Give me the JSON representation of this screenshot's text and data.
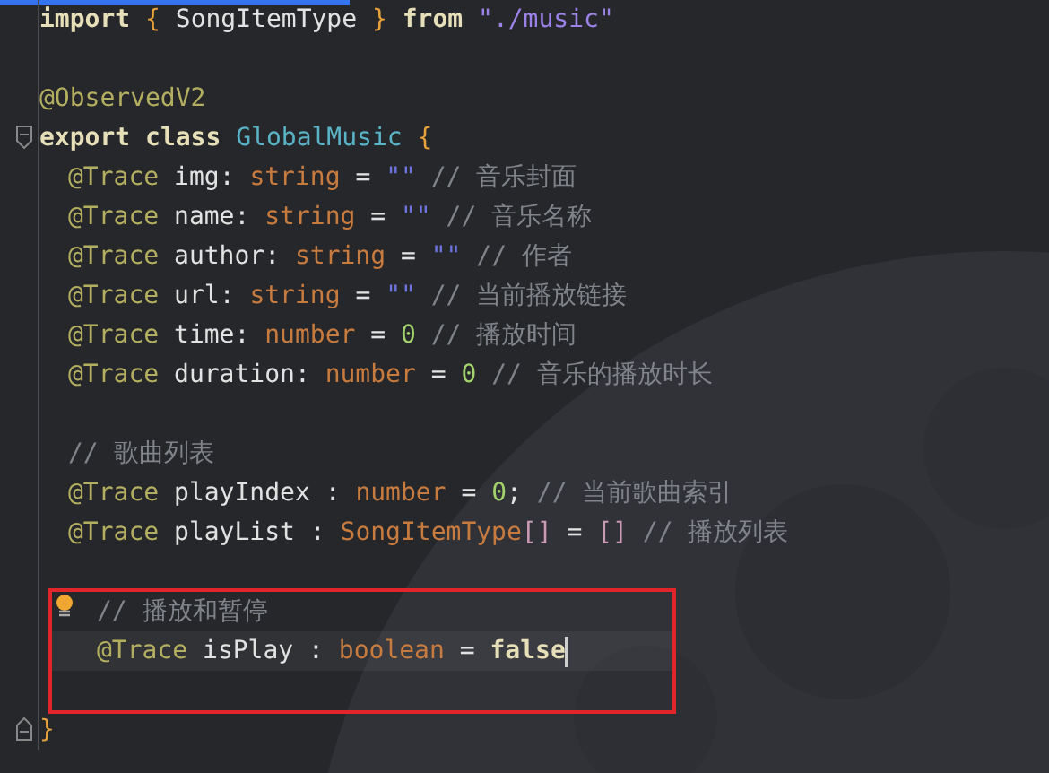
{
  "editor": {
    "lines": [
      {
        "kind": "top",
        "tokens": [
          {
            "kind": "kw",
            "text": "import"
          },
          {
            "kind": "brace",
            "text": "{"
          },
          {
            "kind": "ident",
            "text": "SongItemType"
          },
          {
            "kind": "brace",
            "text": "}"
          },
          {
            "kind": "kw",
            "text": "from"
          },
          {
            "kind": "str",
            "text": "\"./music\""
          }
        ]
      },
      {
        "kind": "blank"
      },
      {
        "kind": "top",
        "tokens": [
          {
            "kind": "deco",
            "text": "@ObservedV2"
          }
        ]
      },
      {
        "kind": "top",
        "fold_start": true,
        "tokens": [
          {
            "kind": "kw",
            "text": "export"
          },
          {
            "kind": "kw",
            "text": "class"
          },
          {
            "kind": "cls",
            "text": "GlobalMusic"
          },
          {
            "kind": "brace",
            "text": "{"
          }
        ]
      },
      {
        "kind": "member",
        "tokens": [
          {
            "kind": "deco",
            "text": "@Trace"
          },
          {
            "kind": "ident",
            "text": "img"
          },
          {
            "kind": "ident",
            "text": ":",
            "join": true
          },
          {
            "kind": "type",
            "text": "string"
          },
          {
            "kind": "ident",
            "text": "="
          },
          {
            "kind": "empty",
            "text": "\"\""
          },
          {
            "kind": "comment",
            "text": "// 音乐封面"
          }
        ]
      },
      {
        "kind": "member",
        "tokens": [
          {
            "kind": "deco",
            "text": "@Trace"
          },
          {
            "kind": "ident",
            "text": "name"
          },
          {
            "kind": "ident",
            "text": ":",
            "join": true
          },
          {
            "kind": "type",
            "text": "string"
          },
          {
            "kind": "ident",
            "text": "="
          },
          {
            "kind": "empty",
            "text": "\"\""
          },
          {
            "kind": "comment",
            "text": "// 音乐名称"
          }
        ]
      },
      {
        "kind": "member",
        "tokens": [
          {
            "kind": "deco",
            "text": "@Trace"
          },
          {
            "kind": "ident",
            "text": "author"
          },
          {
            "kind": "ident",
            "text": ":",
            "join": true
          },
          {
            "kind": "type",
            "text": "string"
          },
          {
            "kind": "ident",
            "text": "="
          },
          {
            "kind": "empty",
            "text": "\"\""
          },
          {
            "kind": "comment",
            "text": "// 作者"
          }
        ]
      },
      {
        "kind": "member",
        "tokens": [
          {
            "kind": "deco",
            "text": "@Trace"
          },
          {
            "kind": "ident",
            "text": "url"
          },
          {
            "kind": "ident",
            "text": ":",
            "join": true
          },
          {
            "kind": "type",
            "text": "string"
          },
          {
            "kind": "ident",
            "text": "="
          },
          {
            "kind": "empty",
            "text": "\"\""
          },
          {
            "kind": "comment",
            "text": "// 当前播放链接"
          }
        ]
      },
      {
        "kind": "member",
        "tokens": [
          {
            "kind": "deco",
            "text": "@Trace"
          },
          {
            "kind": "ident",
            "text": "time"
          },
          {
            "kind": "ident",
            "text": ":",
            "join": true
          },
          {
            "kind": "type",
            "text": "number"
          },
          {
            "kind": "ident",
            "text": "="
          },
          {
            "kind": "num",
            "text": "0"
          },
          {
            "kind": "comment",
            "text": "// 播放时间"
          }
        ]
      },
      {
        "kind": "member",
        "tokens": [
          {
            "kind": "deco",
            "text": "@Trace"
          },
          {
            "kind": "ident",
            "text": "duration"
          },
          {
            "kind": "ident",
            "text": ":",
            "join": true
          },
          {
            "kind": "type",
            "text": "number"
          },
          {
            "kind": "ident",
            "text": "="
          },
          {
            "kind": "num",
            "text": "0"
          },
          {
            "kind": "comment",
            "text": "// 音乐的播放时长"
          }
        ]
      },
      {
        "kind": "blank"
      },
      {
        "kind": "member",
        "tokens": [
          {
            "kind": "comment",
            "text": "// 歌曲列表"
          }
        ]
      },
      {
        "kind": "member",
        "tokens": [
          {
            "kind": "deco",
            "text": "@Trace"
          },
          {
            "kind": "ident",
            "text": "playIndex"
          },
          {
            "kind": "ident",
            "text": ":"
          },
          {
            "kind": "type",
            "text": "number"
          },
          {
            "kind": "ident",
            "text": "="
          },
          {
            "kind": "num",
            "text": "0"
          },
          {
            "kind": "ident",
            "text": ";",
            "join": true
          },
          {
            "kind": "comment",
            "text": "// 当前歌曲索引"
          }
        ]
      },
      {
        "kind": "member",
        "tokens": [
          {
            "kind": "deco",
            "text": "@Trace"
          },
          {
            "kind": "ident",
            "text": "playList"
          },
          {
            "kind": "ident",
            "text": ":"
          },
          {
            "kind": "type",
            "text": "SongItemType"
          },
          {
            "kind": "bracket",
            "text": "[]",
            "join": true
          },
          {
            "kind": "ident",
            "text": "="
          },
          {
            "kind": "bracket",
            "text": "[]"
          },
          {
            "kind": "comment",
            "text": "// 播放列表"
          }
        ]
      },
      {
        "kind": "blank"
      },
      {
        "kind": "member",
        "boxed": true,
        "hint": true,
        "tokens": [
          {
            "kind": "comment",
            "text": "// 播放和暂停"
          }
        ]
      },
      {
        "kind": "member",
        "boxed": true,
        "current": true,
        "caret": true,
        "tokens": [
          {
            "kind": "deco",
            "text": "@Trace"
          },
          {
            "kind": "ident",
            "text": "isPlay"
          },
          {
            "kind": "ident",
            "text": ":"
          },
          {
            "kind": "type",
            "text": "boolean"
          },
          {
            "kind": "ident",
            "text": "="
          },
          {
            "kind": "kw",
            "text": "false"
          }
        ]
      },
      {
        "kind": "blank",
        "boxed": true
      },
      {
        "kind": "top",
        "fold_end": true,
        "tokens": [
          {
            "kind": "brace",
            "text": "}"
          }
        ]
      }
    ]
  }
}
